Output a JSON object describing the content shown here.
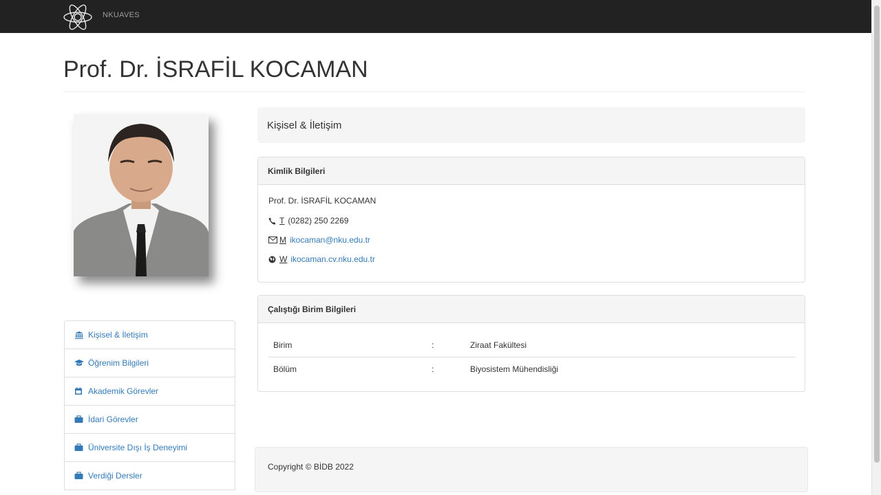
{
  "navbar": {
    "brand": "NKUAVES"
  },
  "page": {
    "title": "Prof. Dr. İSRAFİL KOCAMAN"
  },
  "profile_photo": {
    "alt": "Prof. Dr. İSRAFİL KOCAMAN"
  },
  "section": {
    "title": "Kişisel & İletişim"
  },
  "identity": {
    "heading": "Kimlik Bilgileri",
    "name": "Prof. Dr. İSRAFİL KOCAMAN",
    "phone_label": "T",
    "phone": "(0282) 250 2269",
    "email_label": "M",
    "email": "ikocaman@nku.edu.tr",
    "web_label": "W",
    "web": "ikocaman.cv.nku.edu.tr"
  },
  "unit": {
    "heading": "Çalıştığı Birim Bilgileri",
    "rows": [
      {
        "key": "Birim",
        "sep": ":",
        "value": "Ziraat Fakültesi"
      },
      {
        "key": "Bölüm",
        "sep": ":",
        "value": "Biyosistem Mühendisliği"
      }
    ]
  },
  "sidebar": {
    "items": [
      {
        "label": "Kişisel & İletişim",
        "icon": "building-icon"
      },
      {
        "label": "Öğrenim Bilgileri",
        "icon": "graduation-cap-icon"
      },
      {
        "label": "Akademik Görevler",
        "icon": "calendar-icon"
      },
      {
        "label": "İdari Görevler",
        "icon": "briefcase-icon"
      },
      {
        "label": "Üniversite Dışı İş Deneyimi",
        "icon": "briefcase-icon"
      },
      {
        "label": "Verdiği Dersler",
        "icon": "briefcase-icon"
      }
    ]
  },
  "footer": {
    "text": "Copyright © BİDB 2022"
  },
  "colors": {
    "navbar": "#222222",
    "link": "#337ab7",
    "panel_heading": "#f5f5f5"
  }
}
